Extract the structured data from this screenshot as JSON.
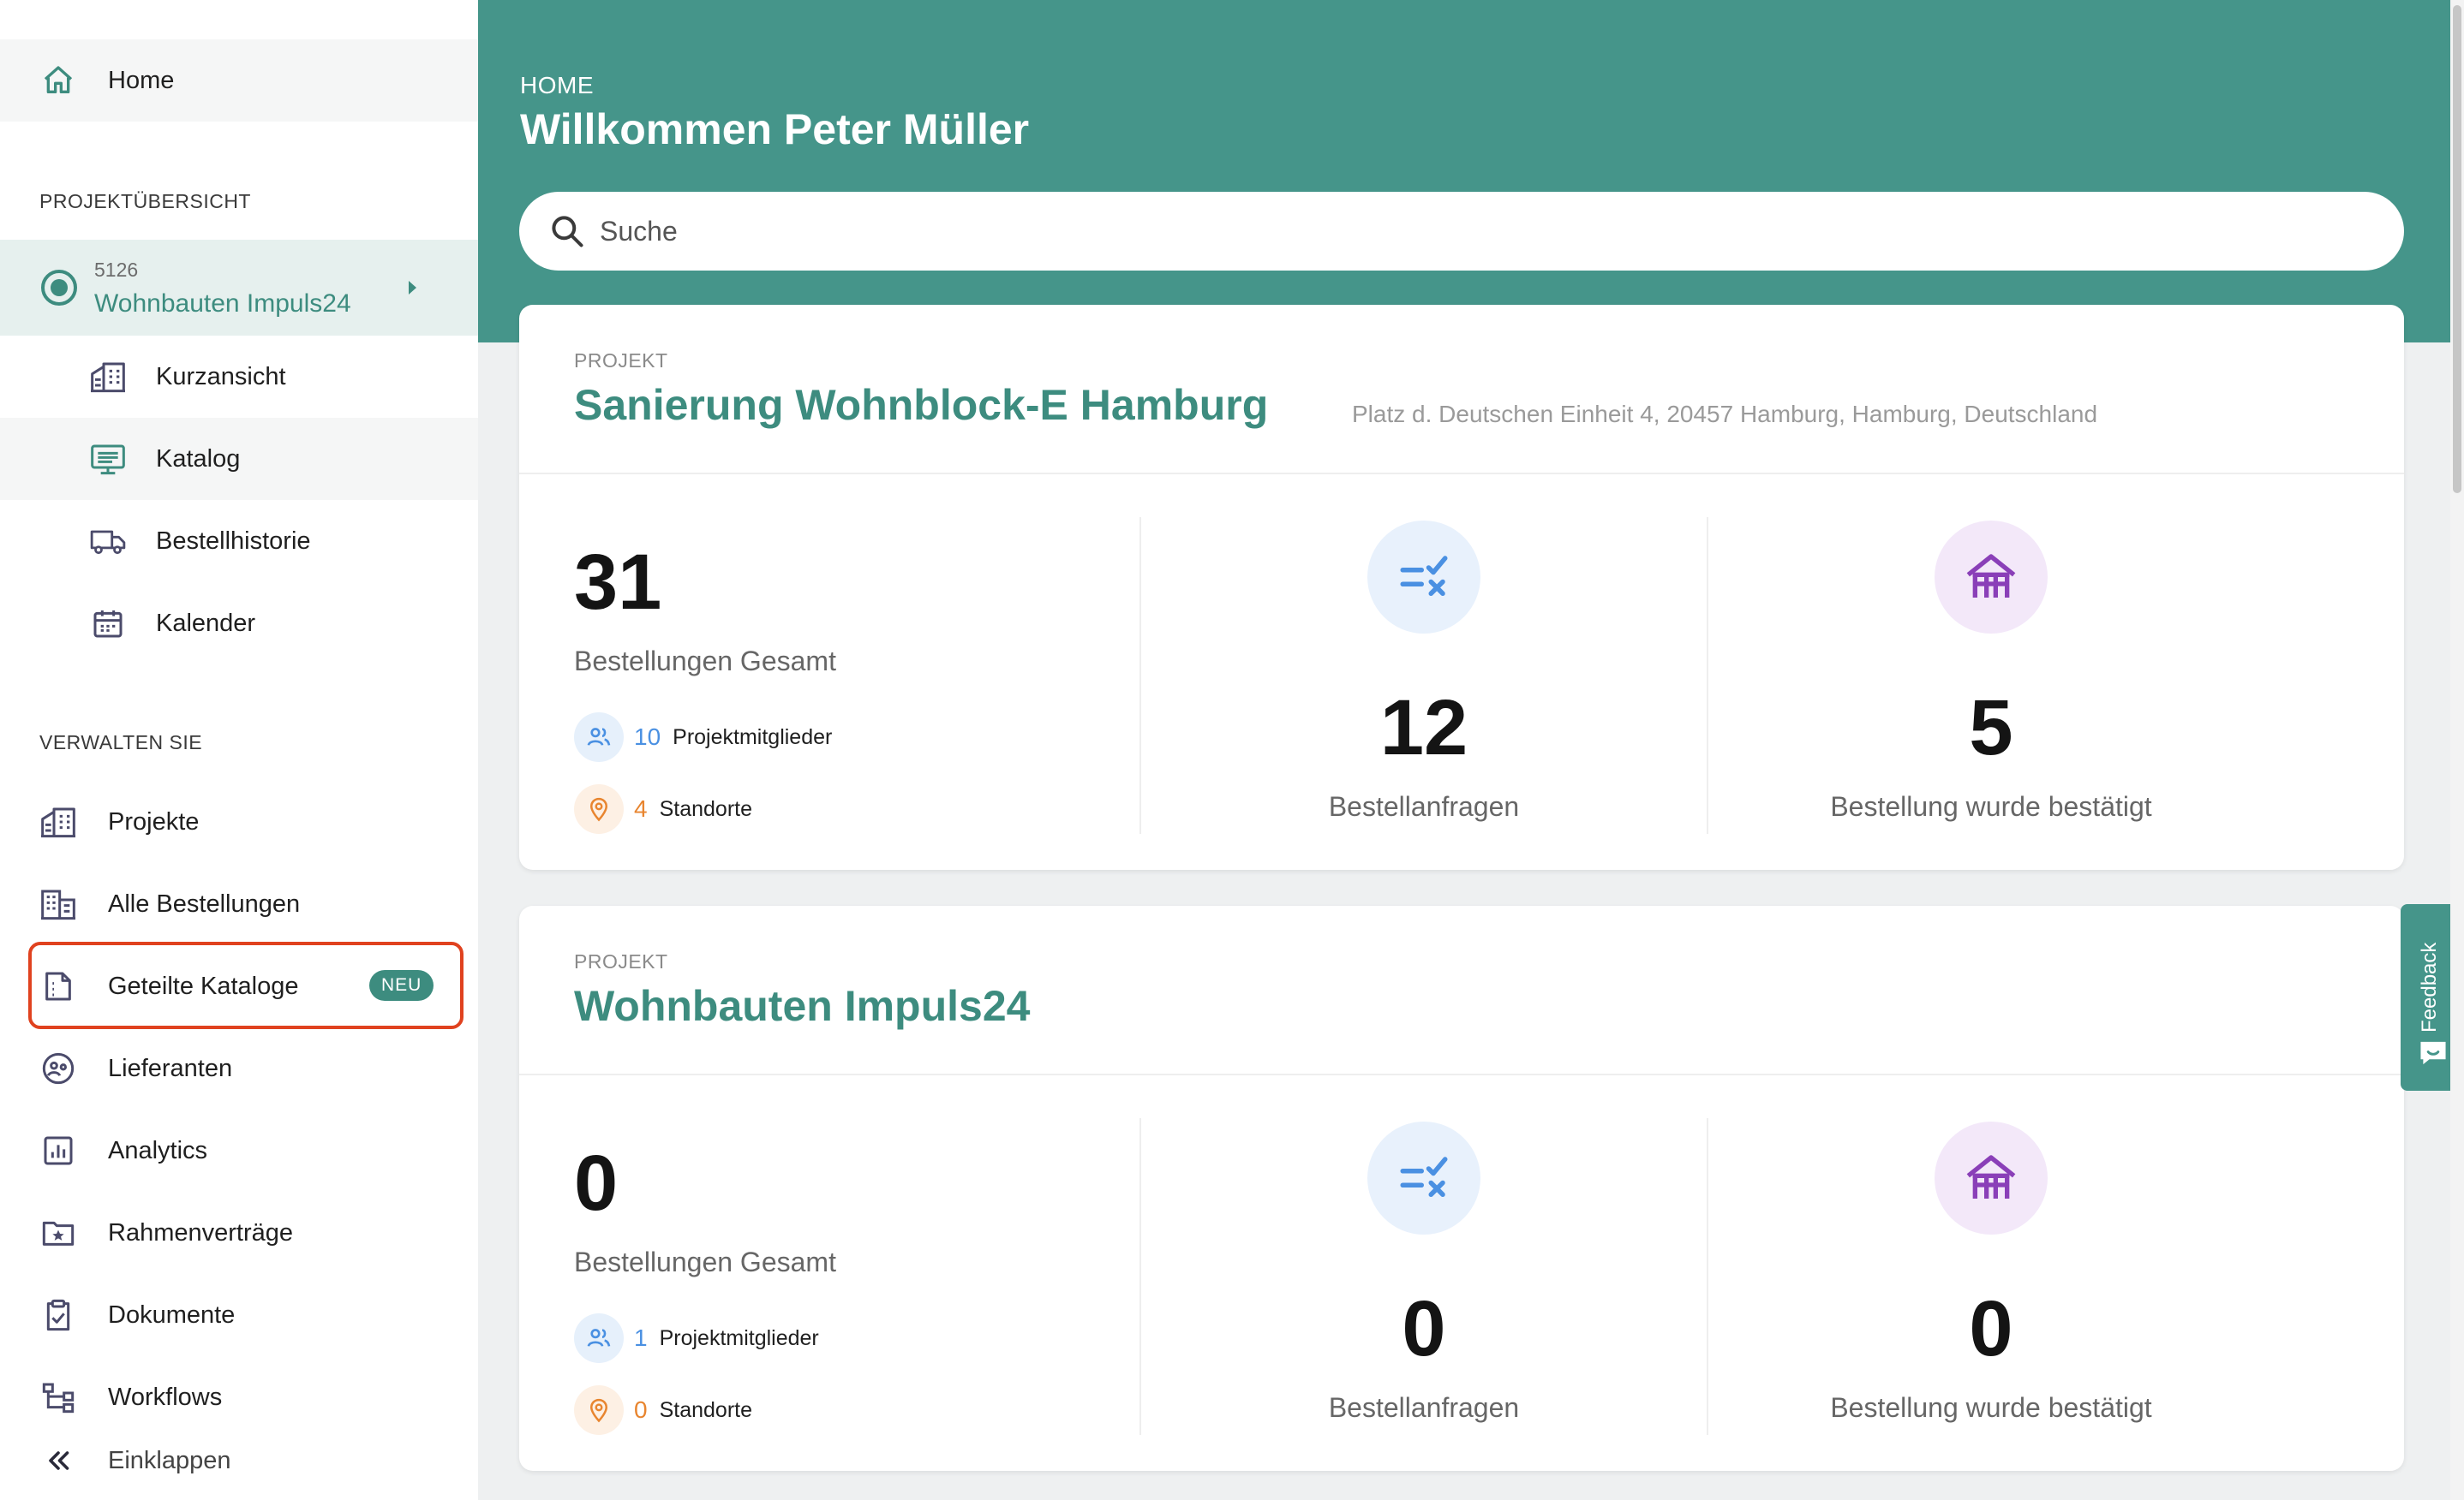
{
  "sidebar": {
    "home_label": "Home",
    "section_projects": "PROJEKTÜBERSICHT",
    "active_project": {
      "number": "5126",
      "name": "Wohnbauten Impuls24"
    },
    "project_subitems": [
      {
        "label": "Kurzansicht",
        "icon": "building-icon"
      },
      {
        "label": "Katalog",
        "icon": "catalog-icon"
      },
      {
        "label": "Bestellhistorie",
        "icon": "truck-icon"
      },
      {
        "label": "Kalender",
        "icon": "calendar-icon"
      }
    ],
    "section_manage": "VERWALTEN SIE",
    "manage_items": [
      {
        "label": "Projekte",
        "icon": "building-icon"
      },
      {
        "label": "Alle Bestellungen",
        "icon": "office-building-icon"
      },
      {
        "label": "Geteilte Kataloge",
        "icon": "document-icon",
        "badge": "NEU"
      },
      {
        "label": "Lieferanten",
        "icon": "supplier-icon"
      },
      {
        "label": "Analytics",
        "icon": "analytics-icon"
      },
      {
        "label": "Rahmenverträge",
        "icon": "folder-star-icon"
      },
      {
        "label": "Dokumente",
        "icon": "clipboard-check-icon"
      },
      {
        "label": "Workflows",
        "icon": "workflow-icon"
      }
    ],
    "collapse_label": "Einklappen"
  },
  "header": {
    "breadcrumb": "HOME",
    "welcome": "Willkommen Peter Müller",
    "search_placeholder": "Suche"
  },
  "projects": [
    {
      "tag": "PROJEKT",
      "title": "Sanierung Wohnblock-E Hamburg",
      "address": "Platz d. Deutschen Einheit 4, 20457 Hamburg, Hamburg, Deutschland",
      "orders_total": "31",
      "orders_total_label": "Bestellungen Gesamt",
      "members_count": "10",
      "members_label": "Projektmitglieder",
      "locations_count": "4",
      "locations_label": "Standorte",
      "requests": "12",
      "requests_label": "Bestellanfragen",
      "confirmed": "5",
      "confirmed_label": "Bestellung wurde bestätigt"
    },
    {
      "tag": "PROJEKT",
      "title": "Wohnbauten Impuls24",
      "orders_total": "0",
      "orders_total_label": "Bestellungen Gesamt",
      "members_count": "1",
      "members_label": "Projektmitglieder",
      "locations_count": "0",
      "locations_label": "Standorte",
      "requests": "0",
      "requests_label": "Bestellanfragen",
      "confirmed": "0",
      "confirmed_label": "Bestellung wurde bestätigt"
    }
  ],
  "feedback_label": "Feedback",
  "colors": {
    "brand": "#45958a",
    "brand_dark": "#3d8c7f",
    "highlight": "#e0421f",
    "members_blue": "#4a90e2",
    "locations_orange": "#e8852f",
    "confirmed_purple": "#8a3fb8"
  }
}
